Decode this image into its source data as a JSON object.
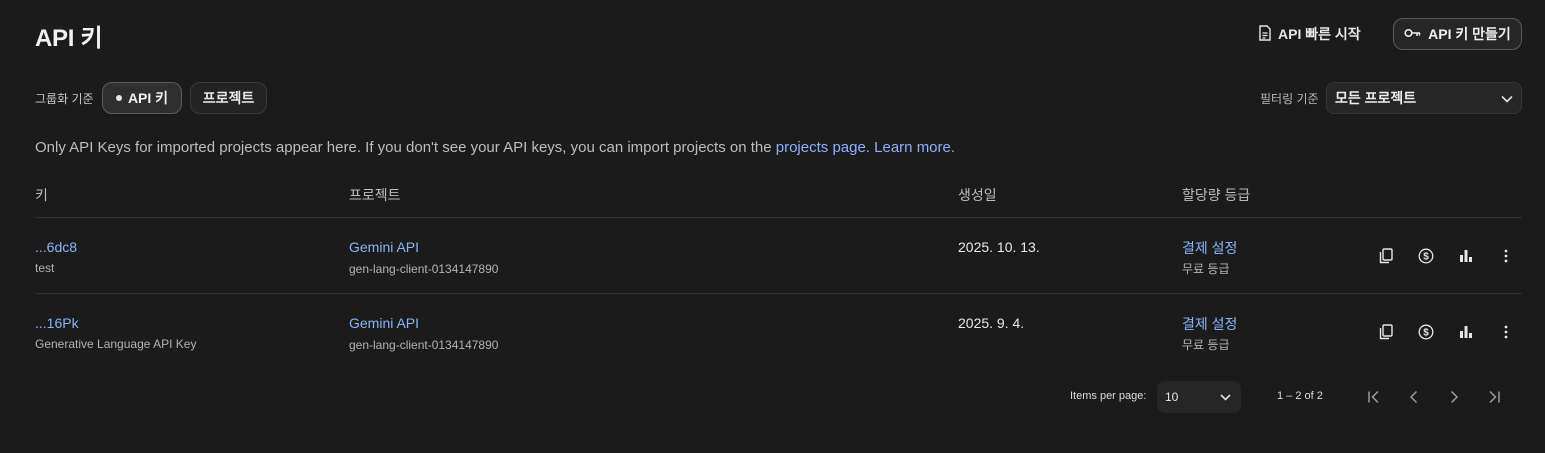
{
  "header": {
    "title": "API 키",
    "quick_start_label": "API 빠른 시작",
    "create_key_label": "API 키 만들기"
  },
  "grouping": {
    "label": "그룹화 기준",
    "options": [
      "API 키",
      "프로젝트"
    ],
    "selected": "API 키"
  },
  "filter": {
    "label": "필터링 기준",
    "value": "모든 프로젝트"
  },
  "notice": {
    "text": "Only API Keys for imported projects appear here. If you don't see your API keys, you can import projects on the ",
    "link1": "projects page.",
    "link2": "Learn more."
  },
  "table": {
    "headers": [
      "키",
      "프로젝트",
      "생성일",
      "할당량 등급"
    ],
    "rows": [
      {
        "key": "...6dc8",
        "key_name": "test",
        "project": "Gemini API",
        "project_id": "gen-lang-client-0134147890",
        "created": "2025. 10. 13.",
        "billing": "결제 설정",
        "tier": "무료 등급"
      },
      {
        "key": "...16Pk",
        "key_name": "Generative Language API Key",
        "project": "Gemini API",
        "project_id": "gen-lang-client-0134147890",
        "created": "2025. 9. 4.",
        "billing": "결제 설정",
        "tier": "무료 등급"
      }
    ],
    "row_actions": [
      "copy-icon",
      "billing-dollar-icon",
      "usage-chart-icon",
      "more-vert-icon"
    ]
  },
  "pagination": {
    "items_per_page_label": "Items per page:",
    "items_per_page": "10",
    "range": "1 – 2 of 2"
  },
  "colors": {
    "background": "#1b1b1b",
    "link": "#8ab4f8",
    "divider": "#333333"
  }
}
